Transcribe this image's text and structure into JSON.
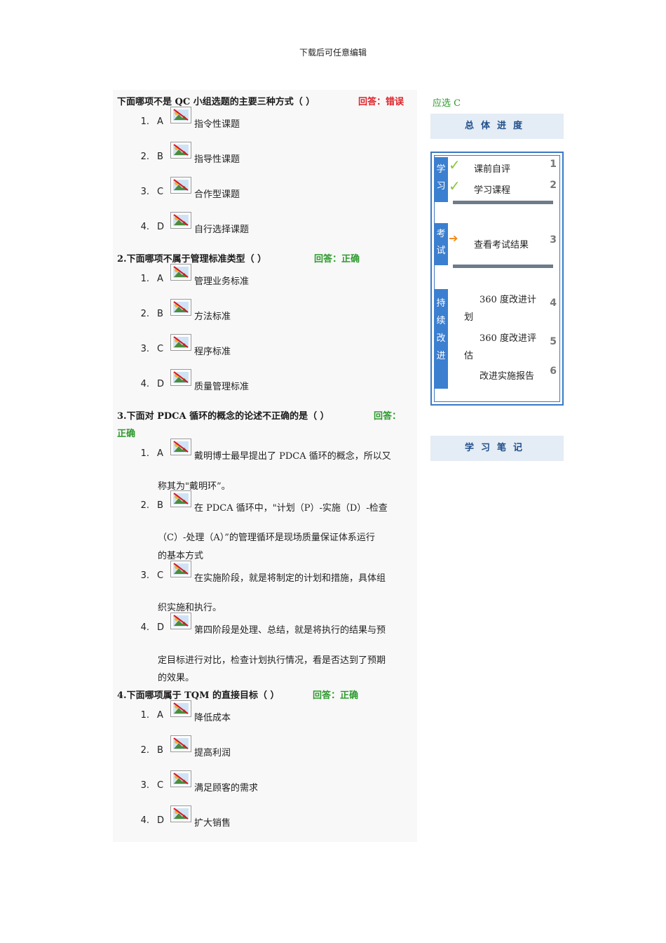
{
  "header_note": "下载后可任意编辑",
  "answer_hint": "应选 C",
  "questions": [
    {
      "text": "下面哪项不是 QC 小组选题的主要三种方式（ ）",
      "answer": "回答：错误",
      "options": [
        {
          "num": "1.",
          "letter": "A",
          "lines": [
            "指令性课题"
          ]
        },
        {
          "num": "2.",
          "letter": "B",
          "lines": [
            "指导性课题"
          ]
        },
        {
          "num": "3.",
          "letter": "C",
          "lines": [
            "合作型课题"
          ]
        },
        {
          "num": "4.",
          "letter": "D",
          "lines": [
            "自行选择课题"
          ]
        }
      ]
    },
    {
      "text": "2.下面哪项不属于管理标准类型（ ）",
      "answer": "回答：正确",
      "options": [
        {
          "num": "1.",
          "letter": "A",
          "lines": [
            "管理业务标准"
          ]
        },
        {
          "num": "2.",
          "letter": "B",
          "lines": [
            "方法标准"
          ]
        },
        {
          "num": "3.",
          "letter": "C",
          "lines": [
            "程序标准"
          ]
        },
        {
          "num": "4.",
          "letter": "D",
          "lines": [
            "质量管理标准"
          ]
        }
      ]
    },
    {
      "text": "3.下面对 PDCA 循环的概念的论述不正确的是（ ）",
      "answer_line1": "回答：",
      "answer_line2": "正确",
      "options": [
        {
          "num": "1.",
          "letter": "A",
          "lines": [
            "戴明博士最早提出了 PDCA 循环的概念，所以又",
            "称其为\"戴明环”。"
          ]
        },
        {
          "num": "2.",
          "letter": "B",
          "lines": [
            "在 PDCA 循环中，\"计划（P）-实施（D）-检查",
            "（C）-处理（A）”的管理循环是现场质量保证体系运行",
            "的基本方式"
          ]
        },
        {
          "num": "3.",
          "letter": "C",
          "lines": [
            "在实施阶段，就是将制定的计划和措施，具体组",
            "织实施和执行。"
          ]
        },
        {
          "num": "4.",
          "letter": "D",
          "lines": [
            "第四阶段是处理、总结，就是将执行的结果与预",
            "定目标进行对比，检查计划执行情况，看是否达到了预期",
            "的效果。"
          ]
        }
      ]
    },
    {
      "text": "4.下面哪项属于 TQM 的直接目标（ ）",
      "answer": "回答：正确",
      "options": [
        {
          "num": "1.",
          "letter": "A",
          "lines": [
            "降低成本"
          ]
        },
        {
          "num": "2.",
          "letter": "B",
          "lines": [
            "提高利润"
          ]
        },
        {
          "num": "3.",
          "letter": "C",
          "lines": [
            "满足顾客的需求"
          ]
        },
        {
          "num": "4.",
          "letter": "D",
          "lines": [
            "扩大销售"
          ]
        }
      ]
    }
  ],
  "sidebar": {
    "progress_title": "总体进度",
    "notes_title": "学习笔记",
    "groups": [
      "学习",
      "考试",
      "持续改进"
    ],
    "steps": [
      {
        "label": "课前自评",
        "index": "1",
        "status": "done"
      },
      {
        "label": "学习课程",
        "index": "2",
        "status": "done"
      },
      {
        "label": "查看考试结果",
        "index": "3",
        "status": "current"
      },
      {
        "label_line1": "360 度改进计",
        "label_line2": "划",
        "index": "4"
      },
      {
        "label_line1": "360 度改进评",
        "label_line2": "估",
        "index": "5"
      },
      {
        "label": "改进实施报告",
        "index": "6"
      }
    ],
    "colors": {
      "panel_border": "#3a79c4",
      "check": "#8cc43c",
      "arrow": "#f08a1c",
      "title_bg": "#e4ecf5"
    }
  }
}
